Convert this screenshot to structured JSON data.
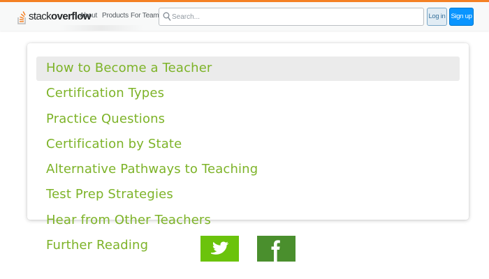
{
  "header": {
    "logo": {
      "icon": "stackoverflow-logo-icon",
      "text_thin": "stack",
      "text_bold": "overflow"
    },
    "nav": [
      {
        "label": "About"
      },
      {
        "label": "Products"
      },
      {
        "label": "For Teams"
      }
    ],
    "search": {
      "icon": "search-icon",
      "placeholder": "Search...",
      "value": ""
    },
    "login_label": "Log in",
    "signup_label": "Sign up"
  },
  "menu": {
    "items": [
      {
        "label": "How to Become a Teacher",
        "highlighted": true
      },
      {
        "label": "Certification Types"
      },
      {
        "label": "Practice Questions"
      },
      {
        "label": "Certification by State"
      },
      {
        "label": "Alternative Pathways to Teaching"
      },
      {
        "label": "Test Prep Strategies"
      },
      {
        "label": "Hear from Other Teachers"
      },
      {
        "label": "Further Reading"
      }
    ]
  },
  "social": [
    {
      "icon": "twitter-icon",
      "color": "#6bc30c"
    },
    {
      "icon": "facebook-icon",
      "color": "#4a8f2d"
    }
  ],
  "colors": {
    "accent_orange": "#f48024",
    "menu_text": "#7db328",
    "signup_blue": "#0a95ff",
    "login_bg": "#e1ecf4"
  }
}
